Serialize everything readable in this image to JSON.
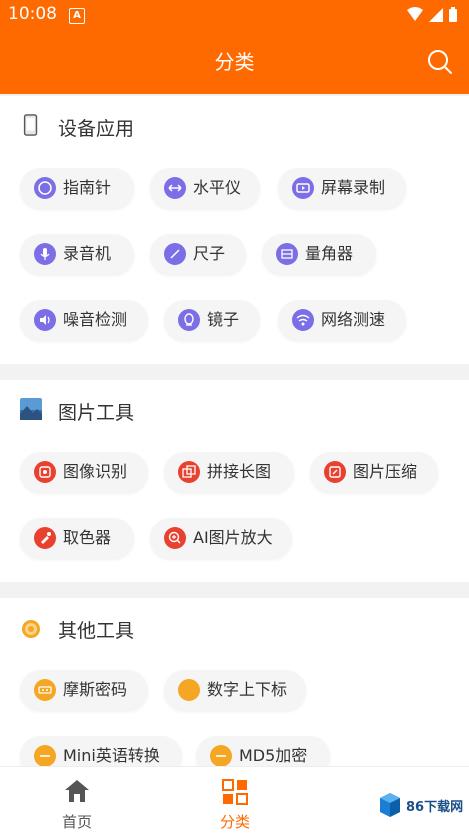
{
  "status_bar": {
    "time": "10:08",
    "notification_letter": "A"
  },
  "header": {
    "title": "分类",
    "search_icon": "search-icon"
  },
  "colors": {
    "brand": "#ff6a00",
    "purple": "#7b6ee6",
    "red": "#e8412f",
    "orange": "#f5a623"
  },
  "sections": [
    {
      "title": "设备应用",
      "icon": "phone-icon",
      "items": [
        {
          "label": "指南针",
          "icon": "compass-icon"
        },
        {
          "label": "水平仪",
          "icon": "level-icon"
        },
        {
          "label": "屏幕录制",
          "icon": "screen-record-icon"
        },
        {
          "label": "录音机",
          "icon": "microphone-icon"
        },
        {
          "label": "尺子",
          "icon": "ruler-icon"
        },
        {
          "label": "量角器",
          "icon": "protractor-icon"
        },
        {
          "label": "噪音检测",
          "icon": "speaker-icon"
        },
        {
          "label": "镜子",
          "icon": "mirror-icon"
        },
        {
          "label": "网络测速",
          "icon": "wifi-icon"
        }
      ]
    },
    {
      "title": "图片工具",
      "icon": "image-icon",
      "items": [
        {
          "label": "图像识别",
          "icon": "camera-icon"
        },
        {
          "label": "拼接长图",
          "icon": "stitch-icon"
        },
        {
          "label": "图片压缩",
          "icon": "compress-icon"
        },
        {
          "label": "取色器",
          "icon": "color-picker-icon"
        },
        {
          "label": "AI图片放大",
          "icon": "zoom-in-icon"
        }
      ]
    },
    {
      "title": "其他工具",
      "icon": "gear-icon",
      "items": [
        {
          "label": "摩斯密码",
          "icon": "morse-icon"
        },
        {
          "label": "数字上下标",
          "icon": "superscript-icon"
        },
        {
          "label": "Mini英语转换",
          "icon": "translate-icon"
        },
        {
          "label": "MD5加密",
          "icon": "encrypt-icon"
        }
      ]
    }
  ],
  "bottom_nav": [
    {
      "label": "首页",
      "icon": "home-icon",
      "active": false
    },
    {
      "label": "分类",
      "icon": "category-icon",
      "active": true
    }
  ],
  "watermark": {
    "text": "86下载网"
  }
}
